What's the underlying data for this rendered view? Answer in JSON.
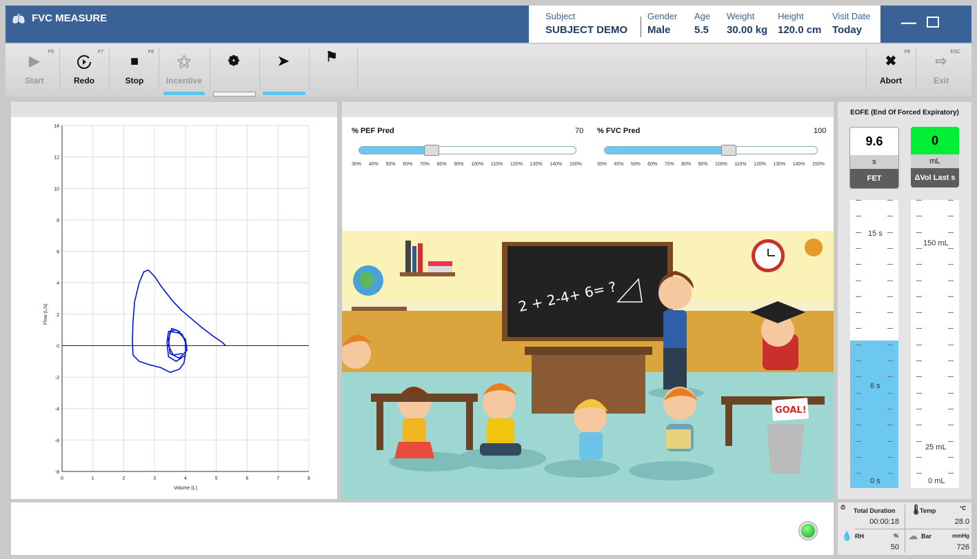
{
  "app": {
    "title": "FVC MEASURE"
  },
  "subject": {
    "fields": [
      {
        "label": "Subject",
        "value": "SUBJECT DEMO"
      },
      {
        "label": "Gender",
        "value": "Male"
      },
      {
        "label": "Age",
        "value": "5.5"
      },
      {
        "label": "Weight",
        "value": "30.00 kg"
      },
      {
        "label": "Height",
        "value": "120.0 cm"
      },
      {
        "label": "Visit Date",
        "value": "Today"
      }
    ]
  },
  "toolbar": {
    "start": {
      "label": "Start",
      "key": "F5"
    },
    "redo": {
      "label": "Redo",
      "key": "F7"
    },
    "stop": {
      "label": "Stop",
      "key": "F6"
    },
    "incentive": {
      "label": "Incentive"
    },
    "abort": {
      "label": "Abort",
      "key": "F8"
    },
    "exit": {
      "label": "Exit",
      "key": "ESC"
    }
  },
  "colors": {
    "title_bar": "#3a6296",
    "accent": "#5ec3ee",
    "status_green": "#00ee33",
    "gauge_fill": "#6cc8ef"
  },
  "icons": [
    "lungs-icon",
    "play-icon",
    "redo-icon",
    "stop-icon",
    "incentive-icon",
    "lungs-cycle-icon",
    "expire-icon",
    "finish-flag-icon",
    "close-icon",
    "exit-icon"
  ],
  "sliders": {
    "pef": {
      "label": "% PEF Pred",
      "value": "70",
      "percent": 70
    },
    "fvc": {
      "label": "% FVC Pred",
      "value": "100",
      "percent": 100
    },
    "tick_labels": [
      "30%",
      "40%",
      "50%",
      "60%",
      "70%",
      "80%",
      "90%",
      "100%",
      "110%",
      "120%",
      "130%",
      "140%",
      "150%"
    ]
  },
  "eofe": {
    "title": "EOFE (End Of Forced Expiratory)",
    "fet": {
      "value": "9.6",
      "unit": "s",
      "name": "FET"
    },
    "dvol": {
      "value": "0",
      "unit": "mL",
      "name": "ΔVol Last s"
    },
    "time_gauge": {
      "labels": [
        "15 s",
        "6 s",
        "0 s"
      ],
      "level_s": 9.6
    },
    "vol_gauge": {
      "labels": [
        "150 mL",
        "25 mL",
        "0 mL"
      ],
      "level_ml": 0
    }
  },
  "environment": {
    "total_duration_label": "Total Duration",
    "total_duration": "00:00:18",
    "temp_label": "Temp",
    "temp_unit": "°C",
    "temp": "28.0",
    "rh_label": "RH",
    "rh_unit": "%",
    "rh": "50",
    "bar_label": "Bar",
    "bar_unit": "mmHg",
    "bar": "726"
  },
  "game": {
    "blackboard_text": "2 + 2-4+ 6= ?",
    "sign_text": "GOAL!"
  },
  "chart_data": {
    "type": "line",
    "title": "",
    "xlabel": "Volume (L)",
    "ylabel": "Flow (L/s)",
    "xlim": [
      0,
      8
    ],
    "ylim": [
      -8,
      14
    ],
    "xticks": [
      0,
      1,
      2,
      3,
      4,
      5,
      6,
      7,
      8
    ],
    "yticks": [
      -8,
      -6,
      -4,
      -2,
      0,
      2,
      4,
      6,
      8,
      10,
      12,
      14
    ],
    "grid": true,
    "series": [
      {
        "color": "#0011dd",
        "points": [
          [
            5.3,
            0.0
          ],
          [
            5.2,
            0.2
          ],
          [
            4.9,
            0.6
          ],
          [
            4.5,
            1.2
          ],
          [
            4.2,
            1.7
          ],
          [
            3.9,
            2.2
          ],
          [
            3.6,
            2.8
          ],
          [
            3.4,
            3.3
          ],
          [
            3.2,
            3.8
          ],
          [
            3.0,
            4.4
          ],
          [
            2.8,
            4.8
          ],
          [
            2.65,
            4.7
          ],
          [
            2.5,
            4.0
          ],
          [
            2.35,
            2.8
          ],
          [
            2.3,
            1.5
          ],
          [
            2.28,
            0.3
          ],
          [
            2.3,
            -0.6
          ],
          [
            2.5,
            -1.0
          ],
          [
            2.8,
            -1.2
          ],
          [
            3.2,
            -1.4
          ],
          [
            3.5,
            -1.7
          ],
          [
            3.8,
            -1.5
          ],
          [
            3.95,
            -1.1
          ],
          [
            4.0,
            -0.5
          ],
          [
            4.0,
            0.2
          ],
          [
            3.9,
            0.7
          ],
          [
            3.7,
            1.0
          ],
          [
            3.45,
            0.9
          ],
          [
            3.4,
            0.2
          ],
          [
            3.45,
            -0.7
          ],
          [
            3.7,
            -1.0
          ],
          [
            4.0,
            -0.6
          ],
          [
            4.0,
            0.3
          ],
          [
            3.8,
            0.9
          ],
          [
            3.55,
            1.1
          ],
          [
            3.45,
            0.4
          ],
          [
            3.5,
            -0.5
          ],
          [
            3.8,
            -0.8
          ],
          [
            4.05,
            -0.3
          ],
          [
            4.0,
            0.4
          ],
          [
            3.8,
            0.8
          ],
          [
            3.5,
            0.9
          ],
          [
            3.45,
            0.0
          ],
          [
            3.6,
            -0.6
          ],
          [
            3.9,
            -0.5
          ]
        ]
      }
    ]
  }
}
